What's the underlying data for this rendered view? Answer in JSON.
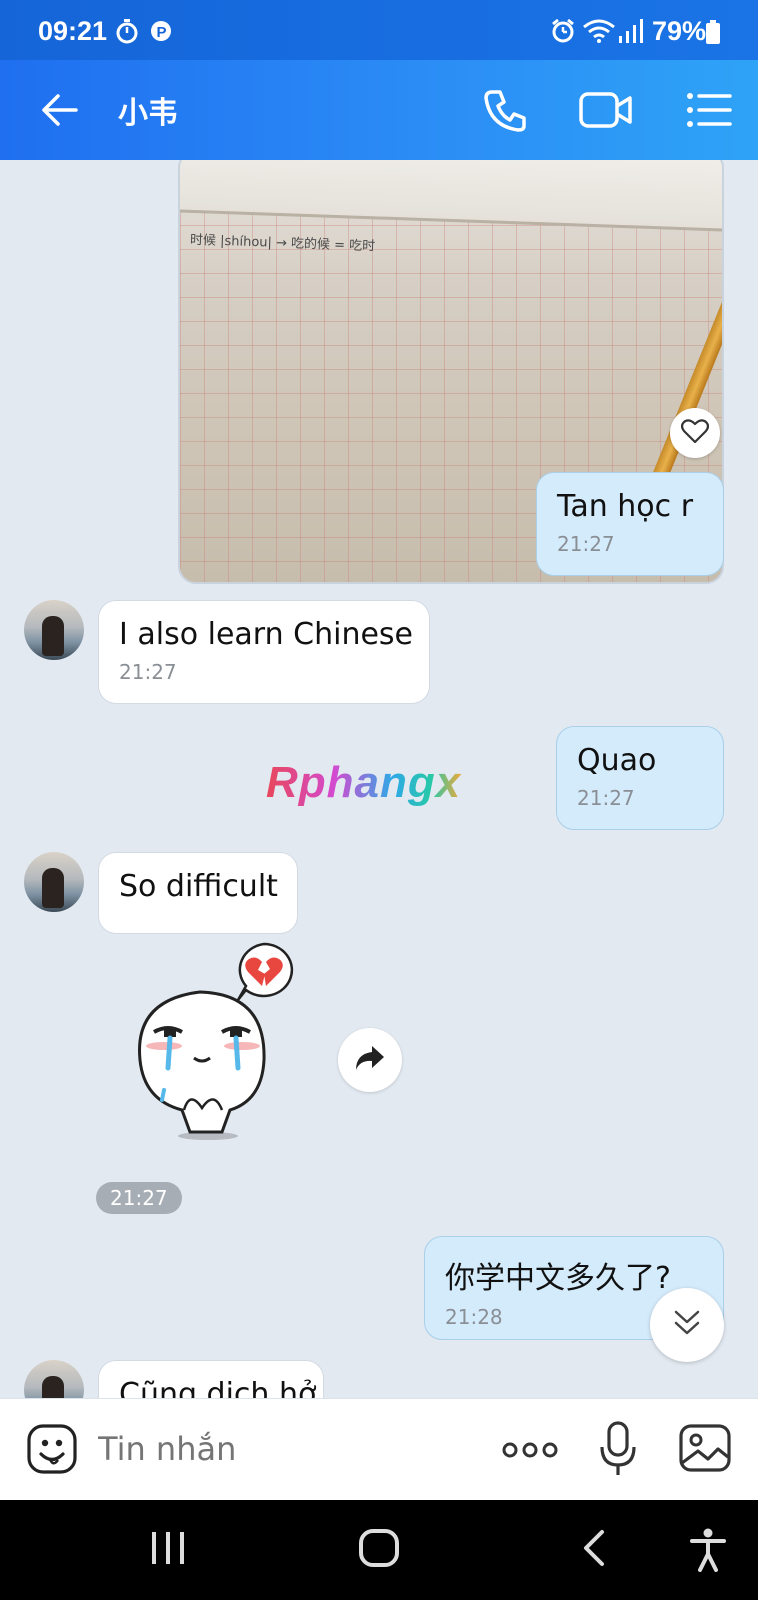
{
  "status_bar": {
    "time": "09:21",
    "battery": "79%",
    "icons": [
      "timer-icon",
      "p-app-icon",
      "alarm-icon",
      "wifi-icon",
      "signal-icon",
      "battery-icon"
    ]
  },
  "header": {
    "title": "小韦",
    "icons": [
      "back-arrow-icon",
      "phone-call-icon",
      "video-call-icon",
      "menu-list-icon"
    ]
  },
  "messages": [
    {
      "type": "image",
      "direction": "incoming",
      "caption_text": "时候 |shíhou| → 吃的候 = 吃时"
    },
    {
      "type": "text",
      "direction": "outgoing",
      "text": "Tan học r",
      "time": "21:27"
    },
    {
      "type": "text",
      "direction": "incoming",
      "text": "I also learn Chinese",
      "time": "21:27"
    },
    {
      "type": "text",
      "direction": "outgoing",
      "text": "Quao",
      "time": "21:27"
    },
    {
      "type": "text",
      "direction": "incoming",
      "text": "So difficult",
      "time": ""
    },
    {
      "type": "sticker",
      "direction": "incoming",
      "time": "21:27"
    },
    {
      "type": "text",
      "direction": "outgoing",
      "text": "你学中文多久了?",
      "time": "21:28"
    },
    {
      "type": "text",
      "direction": "incoming",
      "text": "Cũng dịch hở...",
      "time": ""
    }
  ],
  "watermark": "Rphangx",
  "composer": {
    "placeholder": "Tin nhắn"
  },
  "colors": {
    "header_start": "#1f6ff0",
    "header_end": "#2ea3f7",
    "outgoing_bubble": "#d4ebfb",
    "incoming_bubble": "#ffffff",
    "chat_background": "#e2e9f1"
  }
}
